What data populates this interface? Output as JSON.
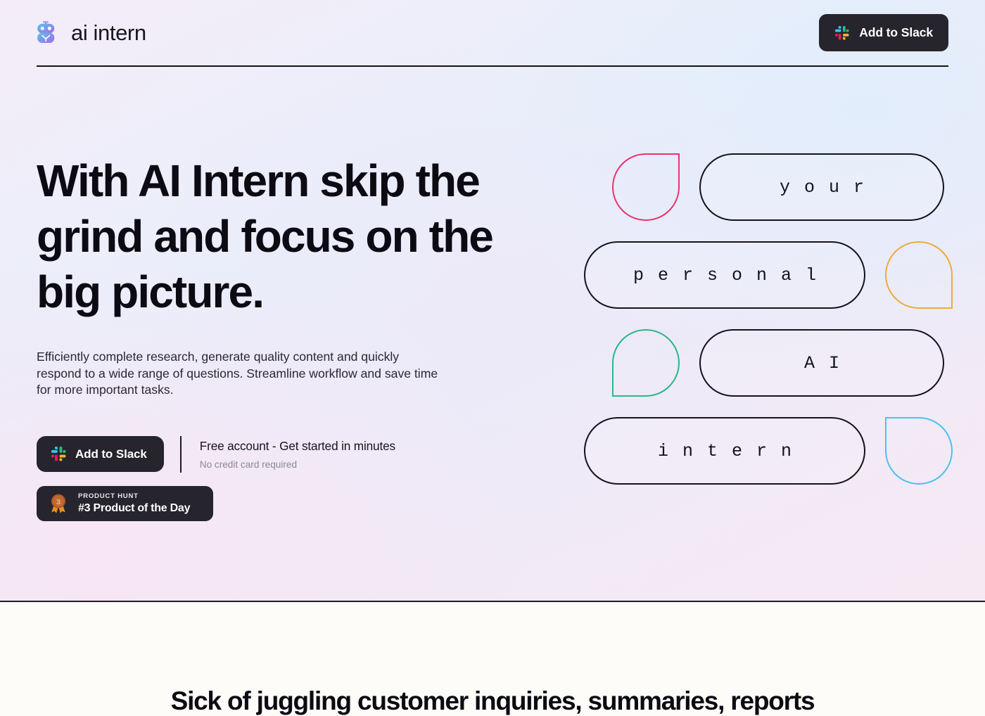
{
  "header": {
    "brand_name": "ai intern",
    "logo_icon": "robot-head-icon",
    "cta_label": "Add to Slack",
    "cta_icon": "slack-icon"
  },
  "hero": {
    "headline": "With AI Intern skip the grind and focus on the big picture.",
    "subcopy": "Efficiently complete research, generate quality content and quickly respond to a wide range of questions. Streamline workflow and save time for more important tasks.",
    "cta": {
      "slack_label": "Add to Slack",
      "slack_icon": "slack-icon",
      "note_main": "Free account - Get started in minutes",
      "note_sub": "No credit card required"
    },
    "product_hunt": {
      "icon": "medal-icon",
      "kicker": "PRODUCT HUNT",
      "title": "#3 Product of the Day",
      "rank": "3"
    },
    "art": {
      "rows": [
        {
          "drop_color": "#e8336d",
          "drop_corner": "top-right",
          "word": "your"
        },
        {
          "drop_color": "#eeab3a",
          "drop_corner": "bottom-right",
          "word": "personal"
        },
        {
          "drop_color": "#2bb784",
          "drop_corner": "bottom-left",
          "word": "AI"
        },
        {
          "drop_color": "#47c3f0",
          "drop_corner": "top-left",
          "word": "intern"
        }
      ]
    }
  },
  "section_two": {
    "title": "Sick of juggling customer inquiries, summaries, reports"
  },
  "colors": {
    "ink": "#0c0a12",
    "button_bg": "#26242c",
    "muted_text": "#8b8896",
    "section_two_bg": "#fdfcf8"
  }
}
